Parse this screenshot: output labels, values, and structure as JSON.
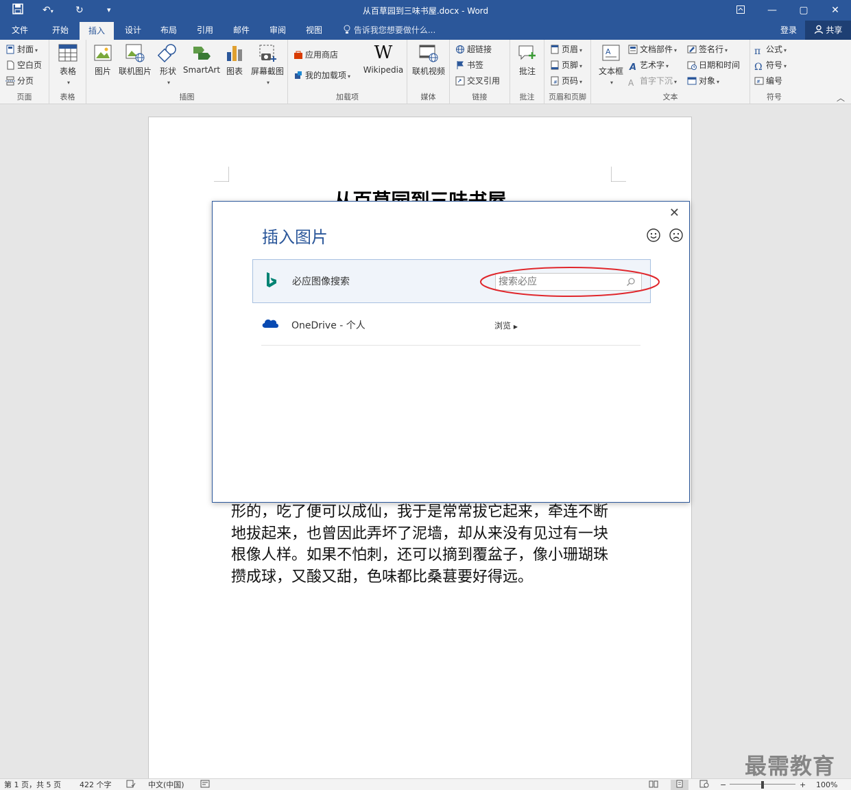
{
  "titlebar": {
    "title": "从百草园到三味书屋.docx - Word"
  },
  "tabs": [
    {
      "label": "文件"
    },
    {
      "label": "开始"
    },
    {
      "label": "插入"
    },
    {
      "label": "设计"
    },
    {
      "label": "布局"
    },
    {
      "label": "引用"
    },
    {
      "label": "邮件"
    },
    {
      "label": "审阅"
    },
    {
      "label": "视图"
    }
  ],
  "tell_me": "告诉我您想要做什么...",
  "account": {
    "login": "登录",
    "share": "共享"
  },
  "ribbon": {
    "pages": {
      "label": "页面",
      "cover": "封面",
      "blank": "空白页",
      "break": "分页"
    },
    "tables": {
      "label": "表格",
      "table": "表格"
    },
    "illustrations": {
      "label": "插图",
      "picture": "图片",
      "online_picture": "联机图片",
      "shapes": "形状",
      "smartart": "SmartArt",
      "chart": "图表",
      "screenshot": "屏幕截图"
    },
    "addins": {
      "label": "加载项",
      "store": "应用商店",
      "my_addins": "我的加载项",
      "wikipedia": "Wikipedia"
    },
    "media": {
      "label": "媒体",
      "online_video": "联机视频"
    },
    "links": {
      "label": "链接",
      "hyperlink": "超链接",
      "bookmark": "书签",
      "crossref": "交叉引用"
    },
    "comments": {
      "label": "批注",
      "comment": "批注"
    },
    "headerfooter": {
      "label": "页眉和页脚",
      "header": "页眉",
      "footer": "页脚",
      "pagenum": "页码"
    },
    "text": {
      "label": "文本",
      "textbox": "文本框",
      "quickparts": "文档部件",
      "wordart": "艺术字",
      "dropcap": "首字下沉",
      "signature": "签名行",
      "datetime": "日期和时间",
      "object": "对象"
    },
    "symbols": {
      "label": "符号",
      "equation": "公式",
      "symbol": "符号",
      "number": "编号"
    }
  },
  "document": {
    "title": "从百草园到三味书屋",
    "paragraph": "形的，吃了便可以成仙，我于是常常拔它起来，牵连不断地拔起来，也曾因此弄坏了泥墙，却从来没有见过有一块根像人样。如果不怕刺，还可以摘到覆盆子，像小珊瑚珠攒成球，又酸又甜，色味都比桑葚要好得远。"
  },
  "dialog": {
    "title": "插入图片",
    "bing": {
      "label": "必应图像搜索",
      "placeholder": "搜索必应"
    },
    "onedrive": {
      "label": "OneDrive - 个人",
      "browse": "浏览"
    }
  },
  "statusbar": {
    "page": "第 1 页，共 5 页",
    "words": "422 个字",
    "language": "中文(中国)",
    "zoom": "100%"
  },
  "watermark": "最需教育",
  "colors": {
    "word_blue": "#2b579a",
    "highlight_red": "#e0262b",
    "bing_teal": "#008373",
    "onedrive_blue": "#094ab2"
  }
}
